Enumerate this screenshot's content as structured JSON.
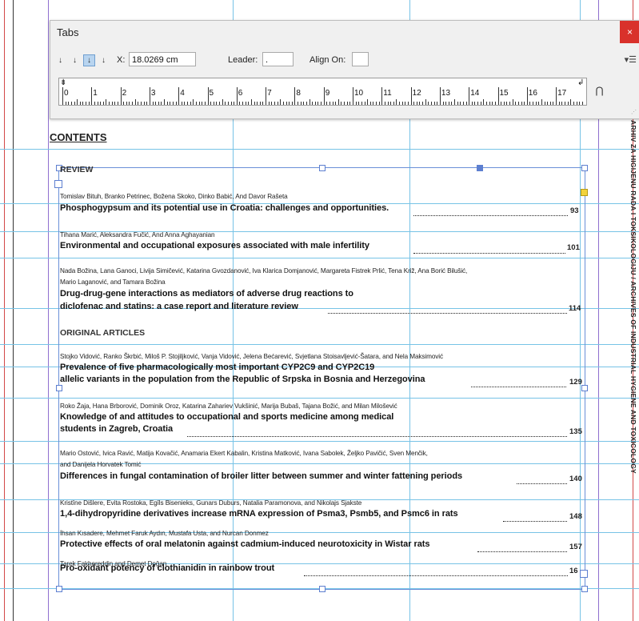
{
  "tabs_panel": {
    "title": "Tabs",
    "close": "×",
    "align_buttons": [
      "left-justified-tab",
      "center-justified-tab",
      "right-justified-tab",
      "align-to-decimal-tab"
    ],
    "align_glyphs": [
      "↓",
      "↓",
      "↓",
      "↓"
    ],
    "selected_align": "right-justified-tab",
    "x_label": "X:",
    "x_value": "18.0269 cm",
    "leader_label": "Leader:",
    "leader_value": ".",
    "align_on_label": "Align On:",
    "align_on_value": "",
    "ruler_numbers": [
      "0",
      "1",
      "2",
      "3",
      "4",
      "5",
      "6",
      "7",
      "8",
      "9",
      "10",
      "11",
      "12",
      "13",
      "14",
      "15",
      "16",
      "17"
    ],
    "menu_icon": "▾☰",
    "magnet_icon": "magnet-icon"
  },
  "document": {
    "heading": "CONTENTS",
    "sections": [
      {
        "label": "REVIEW"
      },
      {
        "label": "ORIGINAL ARTICLES"
      }
    ],
    "entries": [
      {
        "authors": "Tomislav Bituh, Branko Petrinec, Božena Skoko, Dinko Babić, And Davor Rašeta",
        "title_lines": [
          "Phosphogypsum and its potential use in Croatia: challenges and opportunities."
        ],
        "page": "93"
      },
      {
        "authors": "Tihana Marić, Aleksandra Fučić, And Anna Aghayanian",
        "title_lines": [
          "Environmental and occupational exposures associated with male infertility"
        ],
        "page": "101"
      },
      {
        "authors": "Nada Božina, Lana Ganoci, Livija Simičević, Katarina Gvozdanović, Iva Klarica Domjanović, Margareta Fistrek Prlić, Tena Križ, Ana Borić Bilušić,",
        "authors2": "Mario Laganović, and Tamara Božina",
        "title_lines": [
          "Drug-drug-gene interactions as mediators of adverse drug reactions to",
          "diclofenac and statins: a case report and literature review"
        ],
        "page": "114"
      },
      {
        "authors": "Stojko Vidović, Ranko Škrbić, Miloš P. Stojiljković, Vanja Vidović, Jelena Bećarević, Svjetlana Stoisavljević-Šatara, and Nela Maksimović",
        "title_lines": [
          "Prevalence of five pharmacologically most important CYP2C9 and CYP2C19",
          "allelic variants in the population from the Republic of Srpska in Bosnia and Herzegovina"
        ],
        "page": "129"
      },
      {
        "authors": "Roko Žaja, Hana Brborović, Dominik Oroz, Katarina Zahariev Vukšinić, Marija Bubaš, Tajana Božić, and Milan Milošević",
        "title_lines": [
          "Knowledge of and attitudes to occupational and sports medicine among medical",
          "students in Zagreb, Croatia"
        ],
        "page": "135"
      },
      {
        "authors": "Mario Ostović, Ivica Ravić, Matija Kovačić, Anamaria Ekert Kabalin, Kristina Matković, Ivana Sabolek, Željko Pavičić, Sven Menčik,",
        "authors2": "and Danijela Horvatek Tomić",
        "title_lines": [
          "Differences in fungal contamination of broiler litter between summer and winter fattening periods"
        ],
        "page": "140"
      },
      {
        "authors": "Kristīne Dišlere, Evita Rostoka, Egīls Bisenieks, Gunars Duburs, Natalia Paramonova, and Nikolajs Sjakste",
        "title_lines": [
          "1,4-dihydropyridine derivatives increase mRNA expression of Psma3, Psmb5, and Psmc6 in rats"
        ],
        "page": "148"
      },
      {
        "authors": "İhsan Kısadere, Mehmet Faruk Aydın, Mustafa Usta, and Nurcan Donmez",
        "title_lines": [
          "Protective effects of oral melatonin against cadmium-induced neurotoxicity in Wistar rats"
        ],
        "page": "157"
      },
      {
        "authors": "Tarek Fakhereddin and Demet Doğan",
        "title_lines": [
          "Pro-oxidant potency of clothianidin in rainbow trout"
        ],
        "page": "16"
      }
    ],
    "side_running_text": "ARHIV ZA HIGIJENU RADA I TOKSIKOLOGIJU / ARCHIVES OF INDUSTRIAL HYGIENE AND TOXICOLOGY"
  }
}
